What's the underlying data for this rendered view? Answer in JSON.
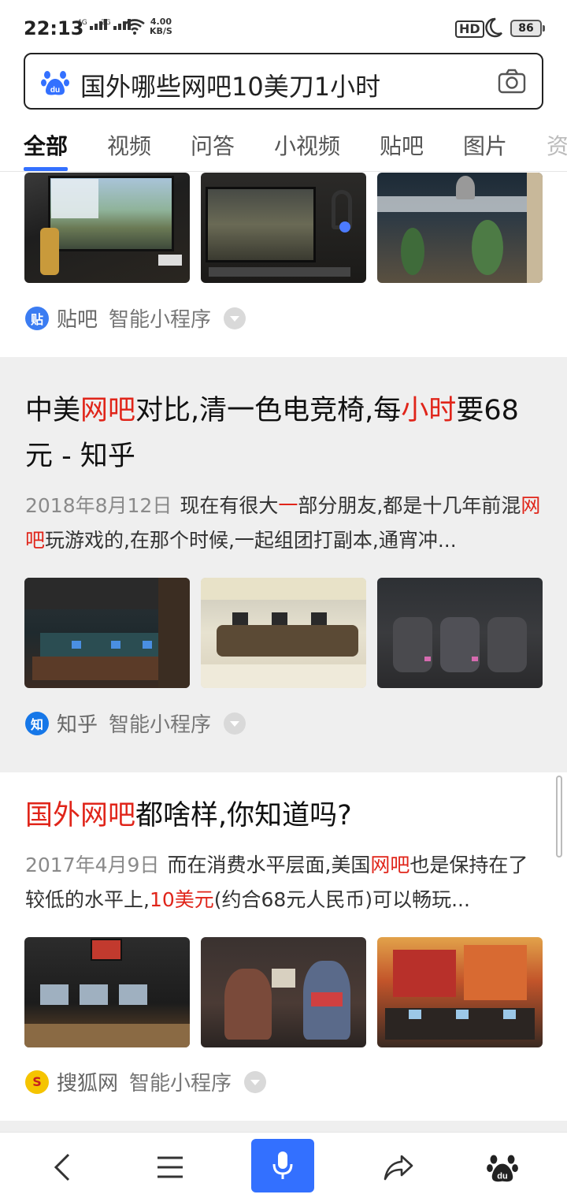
{
  "status_bar": {
    "time": "22:13",
    "net1": "4G",
    "net2": "2G",
    "speed_value": "4.00",
    "speed_unit": "KB/S",
    "hd": "HD",
    "battery": "86"
  },
  "search": {
    "query": "国外哪些网吧10美刀1小时",
    "logo_icon": "baidu-paw-icon",
    "camera_icon": "camera-icon"
  },
  "tabs": [
    "全部",
    "视频",
    "问答",
    "小视频",
    "贴吧",
    "图片",
    "资"
  ],
  "results": [
    {
      "source": "贴吧",
      "source_icon_char": "贴",
      "source_color": "#3b7cf2",
      "mini_program": "智能小程序"
    },
    {
      "title_parts": [
        {
          "text": "中美",
          "hl": false
        },
        {
          "text": "网吧",
          "hl": true
        },
        {
          "text": "对比,清一色电竞椅,每",
          "hl": false
        },
        {
          "text": "小时",
          "hl": true
        },
        {
          "text": "要68元 - 知乎",
          "hl": false
        }
      ],
      "date": "2018年8月12日",
      "snippet_parts": [
        {
          "text": "现在有很大",
          "hl": false
        },
        {
          "text": "一",
          "hl": true
        },
        {
          "text": "部分朋友,都是十几年前混",
          "hl": false
        },
        {
          "text": "网吧",
          "hl": true
        },
        {
          "text": "玩游戏的,在那个时候,一起组团打副本,通宵冲...",
          "hl": false
        }
      ],
      "source": "知乎",
      "source_icon_char": "知",
      "source_color": "#1677e8",
      "mini_program": "智能小程序"
    },
    {
      "title_parts": [
        {
          "text": "国外网吧",
          "hl": true
        },
        {
          "text": "都啥样,你知道吗?",
          "hl": false
        }
      ],
      "date": "2017年4月9日",
      "snippet_parts": [
        {
          "text": "而在消费水平层面,美国",
          "hl": false
        },
        {
          "text": "网吧",
          "hl": true
        },
        {
          "text": "也是保持在了较低的水平上,",
          "hl": false
        },
        {
          "text": "10美元",
          "hl": true
        },
        {
          "text": "(约合68元人民币)可以畅玩...",
          "hl": false
        }
      ],
      "source": "搜狐网",
      "source_icon_char": "S",
      "source_color": "#f5c400",
      "mini_program": "智能小程序"
    }
  ],
  "bottom_nav": {
    "back_icon": "back-arrow-icon",
    "menu_icon": "menu-icon",
    "mic_icon": "microphone-icon",
    "share_icon": "share-icon",
    "home_icon": "baidu-paw-icon"
  },
  "colors": {
    "accent": "#3370ff",
    "highlight": "#e0251a"
  }
}
